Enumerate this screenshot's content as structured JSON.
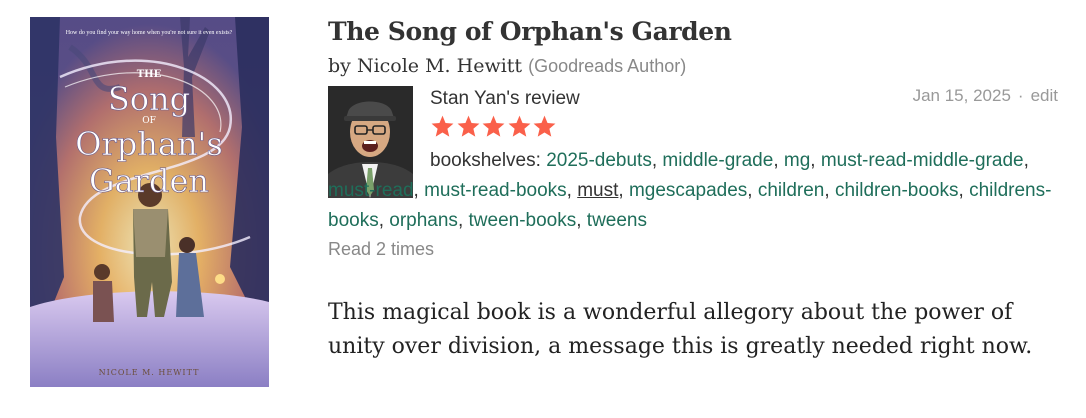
{
  "book": {
    "cover_tagline": "How do you find your way home when you're not sure it even exists?",
    "cover_title_line1": "THE",
    "cover_title_line2": "Song",
    "cover_title_line3": "OF",
    "cover_title_line4": "Orphan's",
    "cover_title_line5": "Garden",
    "cover_author": "NICOLE M. HEWITT",
    "title": "The Song of Orphan's Garden",
    "by_prefix": "by",
    "author": "Nicole M. Hewitt",
    "author_tag": "(Goodreads Author)"
  },
  "review": {
    "reviewer_name": "Stan Yan",
    "reviewer_suffix": "'s review",
    "date": "Jan 15, 2025",
    "separator": "·",
    "edit_label": "edit",
    "rating": 5,
    "star_color": "#fa604a",
    "shelves_label": "bookshelves:",
    "shelves": [
      "2025-debuts",
      "middle-grade",
      "mg",
      "must-read-middle-grade",
      "must-read",
      "must-read-books",
      "must",
      "mgescapades",
      "children",
      "children-books",
      "childrens-books",
      "orphans",
      "tween-books",
      "tweens"
    ],
    "read_count": "Read 2 times",
    "body": "This magical book is a wonderful allegory about the power of unity over division, a message this is greatly needed right now."
  },
  "colors": {
    "link_green": "#1f6e5a",
    "muted_gray": "#888888"
  }
}
